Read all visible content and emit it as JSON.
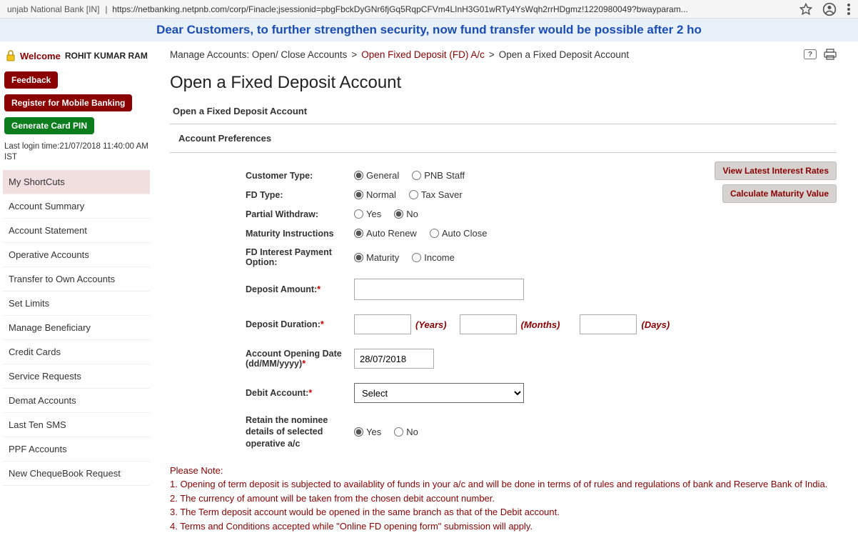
{
  "browser": {
    "title": "unjab National Bank [IN]",
    "url": "https://netbanking.netpnb.com/corp/Finacle;jsessionid=pbgFbckDyGNr6fjGq5RqpCFVm4LInH3G01wRTy4YsWqh2rrHDgmz!1220980049?bwayparam..."
  },
  "marquee": "Dear Customers, to further strengthen security, now fund transfer would be possible after 2 ho",
  "sidebar": {
    "welcome_label": "Welcome",
    "welcome_name": "ROHIT KUMAR RAM",
    "feedback": "Feedback",
    "register_mobile": "Register for Mobile Banking",
    "generate_pin": "Generate Card PIN",
    "last_login_label": "Last login time:",
    "last_login_value": "21/07/2018 11:40:00 AM IST",
    "menu": [
      "My ShortCuts",
      "Account Summary",
      "Account Statement",
      "Operative Accounts",
      "Transfer to Own Accounts",
      "Set Limits",
      "Manage Beneficiary",
      "Credit Cards",
      "Service Requests",
      "Demat Accounts",
      "Last Ten SMS",
      "PPF Accounts",
      "New ChequeBook Request"
    ]
  },
  "breadcrumb": {
    "p1": "Manage Accounts: Open/ Close Accounts",
    "sep": ">",
    "p2": "Open Fixed Deposit (FD) A/c",
    "p3": "Open a Fixed Deposit Account"
  },
  "page_title": "Open a Fixed Deposit Account",
  "sub_title": "Open a Fixed Deposit Account",
  "section_header": "Account Preferences",
  "buttons": {
    "view_rates": "View Latest Interest Rates",
    "calc_maturity": "Calculate Maturity Value"
  },
  "form": {
    "customer_type": {
      "label": "Customer Type:",
      "opt1": "General",
      "opt2": "PNB Staff"
    },
    "fd_type": {
      "label": "FD Type:",
      "opt1": "Normal",
      "opt2": "Tax Saver"
    },
    "partial_withdraw": {
      "label": "Partial Withdraw:",
      "opt1": "Yes",
      "opt2": "No"
    },
    "maturity_instr": {
      "label": "Maturity Instructions",
      "opt1": "Auto Renew",
      "opt2": "Auto Close"
    },
    "fd_payment": {
      "label": "FD Interest Payment Option:",
      "opt1": "Maturity",
      "opt2": "Income"
    },
    "deposit_amount": {
      "label": "Deposit Amount:"
    },
    "deposit_duration": {
      "label": "Deposit Duration:",
      "years": "(Years)",
      "months": "(Months)",
      "days": "(Days)"
    },
    "opening_date": {
      "label": "Account Opening Date (dd/MM/yyyy)",
      "value": "28/07/2018"
    },
    "debit_account": {
      "label": "Debit Account:",
      "placeholder": "Select"
    },
    "retain_nominee": {
      "label": "Retain the nominee details of selected operative a/c",
      "opt1": "Yes",
      "opt2": "No"
    }
  },
  "notes": {
    "header": "Please Note:",
    "l1": "1. Opening of term deposit is subjected to availablity of funds in your a/c and will be done in terms of of rules and regulations of bank and Reserve Bank of India.",
    "l2": "2. The currency of amount will be taken from the chosen debit account number.",
    "l3": "3. The Term deposit account would be opened in the same branch as that of the Debit account.",
    "l4": "4. Terms and Conditions accepted while \"Online FD opening form\" submission will apply."
  }
}
